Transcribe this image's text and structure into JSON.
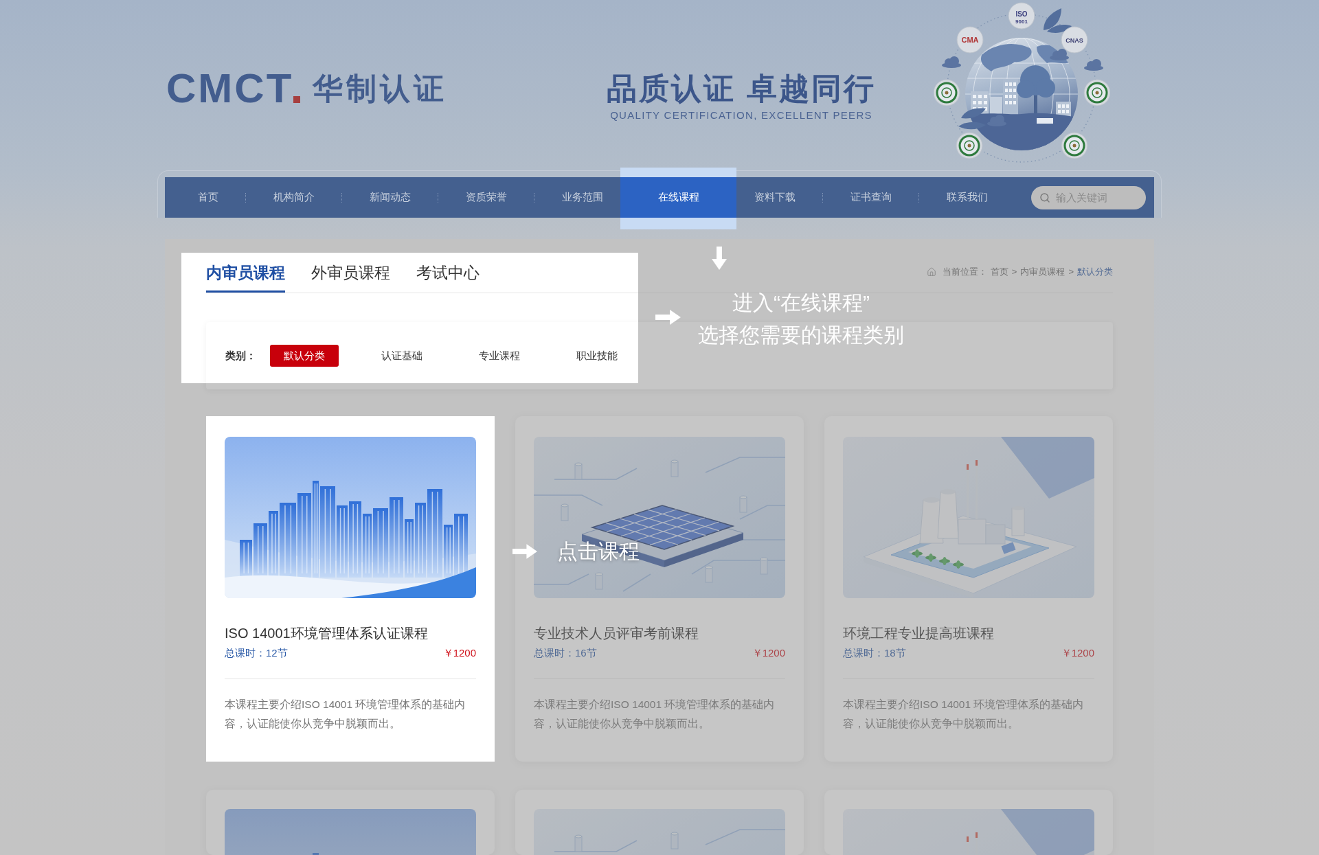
{
  "header": {
    "logo_mark": "CMCT",
    "logo_name": "华制认证",
    "slogan": "品质认证 卓越同行",
    "slogan_en": "QUALITY CERTIFICATION, EXCELLENT PEERS",
    "badges": [
      {
        "text": "ISO",
        "subtext": "9001"
      },
      {
        "text": "CMA"
      },
      {
        "text": "CNAS"
      }
    ]
  },
  "nav": {
    "items": [
      {
        "label": "首页",
        "selected": false
      },
      {
        "label": "机构简介",
        "selected": false
      },
      {
        "label": "新闻动态",
        "selected": false
      },
      {
        "label": "资质荣誉",
        "selected": false
      },
      {
        "label": "业务范围",
        "selected": false
      },
      {
        "label": "在线课程",
        "selected": true
      },
      {
        "label": "资料下载",
        "selected": false
      },
      {
        "label": "证书查询",
        "selected": false
      },
      {
        "label": "联系我们",
        "selected": false
      }
    ],
    "search": {
      "placeholder": "输入关键词"
    }
  },
  "course_filter": {
    "highlighted": true,
    "tabs": [
      {
        "label": "内审员课程",
        "selected": true
      },
      {
        "label": "外审员课程",
        "selected": false
      },
      {
        "label": "考试中心",
        "selected": false
      }
    ],
    "breadcrumb": {
      "label": "当前位置：",
      "separator": ">",
      "items": [
        "首页",
        "内审员课程",
        "默认分类"
      ]
    },
    "category": {
      "label": "类别：",
      "options": [
        {
          "label": "默认分类",
          "selected": true
        },
        {
          "label": "认证基础",
          "selected": false
        },
        {
          "label": "专业课程",
          "selected": false
        },
        {
          "label": "职业技能",
          "selected": false
        }
      ]
    }
  },
  "courses": [
    {
      "title": "ISO 14001环境管理体系认证课程",
      "hours": "总课时：12节",
      "price": "￥1200",
      "description": "本课程主要介绍ISO 14001 环境管理体系的基础内容，认证能使你从竞争中脱颖而出。",
      "highlighted": true
    },
    {
      "title": "专业技术人员评审考前课程",
      "hours": "总课时：16节",
      "price": "￥1200",
      "description": "本课程主要介绍ISO 14001 环境管理体系的基础内容，认证能使你从竞争中脱颖而出。",
      "highlighted": false
    },
    {
      "title": "环境工程专业提高班课程",
      "hours": "总课时：18节",
      "price": "￥1200",
      "description": "本课程主要介绍ISO 14001 环境管理体系的基础内容，认证能使你从竞争中脱颖而出。",
      "highlighted": false
    },
    {
      "highlighted": false
    },
    {
      "highlighted": false
    },
    {
      "highlighted": false
    }
  ],
  "guide": {
    "step_1": [
      "进入“在线课程”",
      "选择您需要的课程类别"
    ],
    "step_2": "点击课程"
  }
}
